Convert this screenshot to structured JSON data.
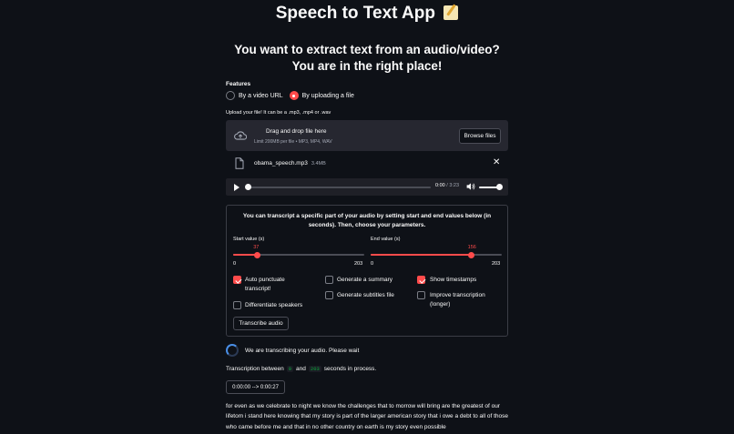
{
  "app": {
    "title": "Speech to Text App",
    "title_icon": "memo-icon",
    "subtitle": "You want to extract text from an audio/video? You are in the right place!"
  },
  "features": {
    "label": "Features",
    "options": [
      {
        "label": "By a video URL",
        "selected": false
      },
      {
        "label": "By uploading a file",
        "selected": true
      }
    ]
  },
  "upload": {
    "label": "Upload your file! It can be a .mp3, .mp4 or .wav",
    "drag_text": "Drag and drop file here",
    "limit_text": "Limit 200MB per file • MP3, MP4, WAV",
    "browse_label": "Browse files",
    "file_name": "obama_speech.mp3",
    "file_size": "3.4MB"
  },
  "audio": {
    "current": "0:00",
    "separator": " / ",
    "duration": "3:23",
    "progress": 0,
    "volume": 1.0
  },
  "params": {
    "instructions": "You can transcript a specific part of your audio by setting start and end values below (in seconds). Then, choose your parameters.",
    "start": {
      "label": "Start value (s)",
      "min": 0,
      "max": 203,
      "value": 37,
      "min_label": "0",
      "max_label": "203",
      "value_label": "37"
    },
    "end": {
      "label": "End value (s)",
      "min": 0,
      "max": 203,
      "value": 156,
      "min_label": "0",
      "max_label": "203",
      "value_label": "156"
    },
    "checkboxes": [
      {
        "label": "Auto punctuate transcript!",
        "checked": true
      },
      {
        "label": "Generate a summary",
        "checked": false
      },
      {
        "label": "Show timestamps",
        "checked": true
      },
      {
        "label": "Differentiate speakers",
        "checked": false
      },
      {
        "label": "Generate subtitles file",
        "checked": false
      },
      {
        "label": "Improve transcription (longer)",
        "checked": false
      }
    ],
    "transcribe_label": "Transcribe audio"
  },
  "status": {
    "spinner_text": "We are transcribing your audio. Please wait",
    "process_prefix": "Transcription between",
    "process_start": "0",
    "process_mid": "and",
    "process_end": "203",
    "process_suffix": "seconds in process.",
    "timestamp": "0:00:00 --> 0:00:27",
    "transcript": "for even as we celebrate to night we know the challenges that to morrow will bring are the greatest of our lifetom i stand here knowing that my story is part of the larger american story that i owe a debt to all of those who came before me and that in no other country on earth is my story even possible"
  },
  "colors": {
    "background": "#0e1117",
    "accent": "#ff4b4b",
    "surface": "#262730",
    "code_green": "#09ab3b"
  }
}
